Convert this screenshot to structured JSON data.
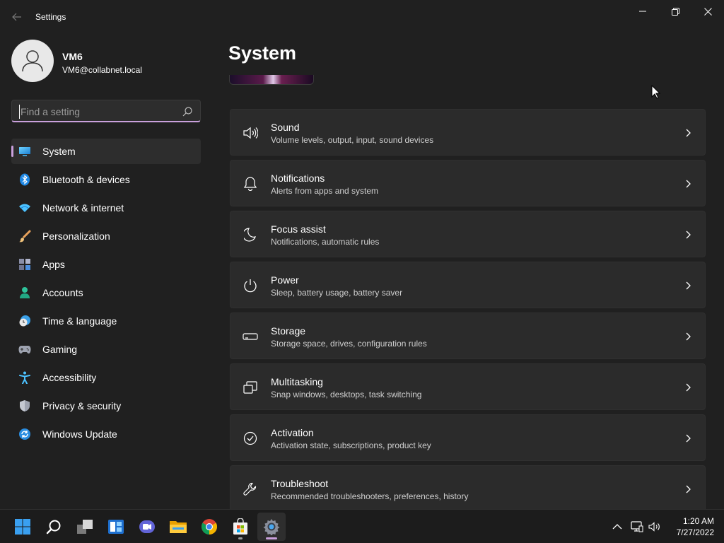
{
  "window": {
    "title": "Settings",
    "min_glyph": "—",
    "close_glyph": "✕"
  },
  "user": {
    "name": "VM6",
    "email": "VM6@collabnet.local"
  },
  "search": {
    "placeholder": "Find a setting",
    "value": ""
  },
  "sidebar": {
    "items": [
      {
        "label": "System",
        "icon": "monitor-icon",
        "active": true
      },
      {
        "label": "Bluetooth & devices",
        "icon": "bluetooth-icon"
      },
      {
        "label": "Network & internet",
        "icon": "wifi-icon"
      },
      {
        "label": "Personalization",
        "icon": "brush-icon"
      },
      {
        "label": "Apps",
        "icon": "apps-icon"
      },
      {
        "label": "Accounts",
        "icon": "person-icon"
      },
      {
        "label": "Time & language",
        "icon": "clock-globe-icon"
      },
      {
        "label": "Gaming",
        "icon": "gamepad-icon"
      },
      {
        "label": "Accessibility",
        "icon": "accessibility-icon"
      },
      {
        "label": "Privacy & security",
        "icon": "shield-icon"
      },
      {
        "label": "Windows Update",
        "icon": "update-icon"
      }
    ]
  },
  "main": {
    "title": "System",
    "cards": [
      {
        "title": "Sound",
        "subtitle": "Volume levels, output, input, sound devices",
        "icon": "speaker-icon"
      },
      {
        "title": "Notifications",
        "subtitle": "Alerts from apps and system",
        "icon": "bell-icon"
      },
      {
        "title": "Focus assist",
        "subtitle": "Notifications, automatic rules",
        "icon": "moon-icon"
      },
      {
        "title": "Power",
        "subtitle": "Sleep, battery usage, battery saver",
        "icon": "power-icon"
      },
      {
        "title": "Storage",
        "subtitle": "Storage space, drives, configuration rules",
        "icon": "drive-icon"
      },
      {
        "title": "Multitasking",
        "subtitle": "Snap windows, desktops, task switching",
        "icon": "multitask-icon"
      },
      {
        "title": "Activation",
        "subtitle": "Activation state, subscriptions, product key",
        "icon": "check-circle-icon"
      },
      {
        "title": "Troubleshoot",
        "subtitle": "Recommended troubleshooters, preferences, history",
        "icon": "wrench-icon"
      }
    ]
  },
  "taskbar": {
    "apps": [
      "start-icon",
      "search-icon",
      "task-view-icon",
      "widgets-icon",
      "teams-chat-icon",
      "file-explorer-icon",
      "chrome-icon",
      "store-icon",
      "settings-icon"
    ],
    "time": "1:20 AM",
    "date": "7/27/2022"
  },
  "colors": {
    "accent": "#c9a0dc",
    "background": "#202020",
    "card": "#2b2b2b"
  }
}
